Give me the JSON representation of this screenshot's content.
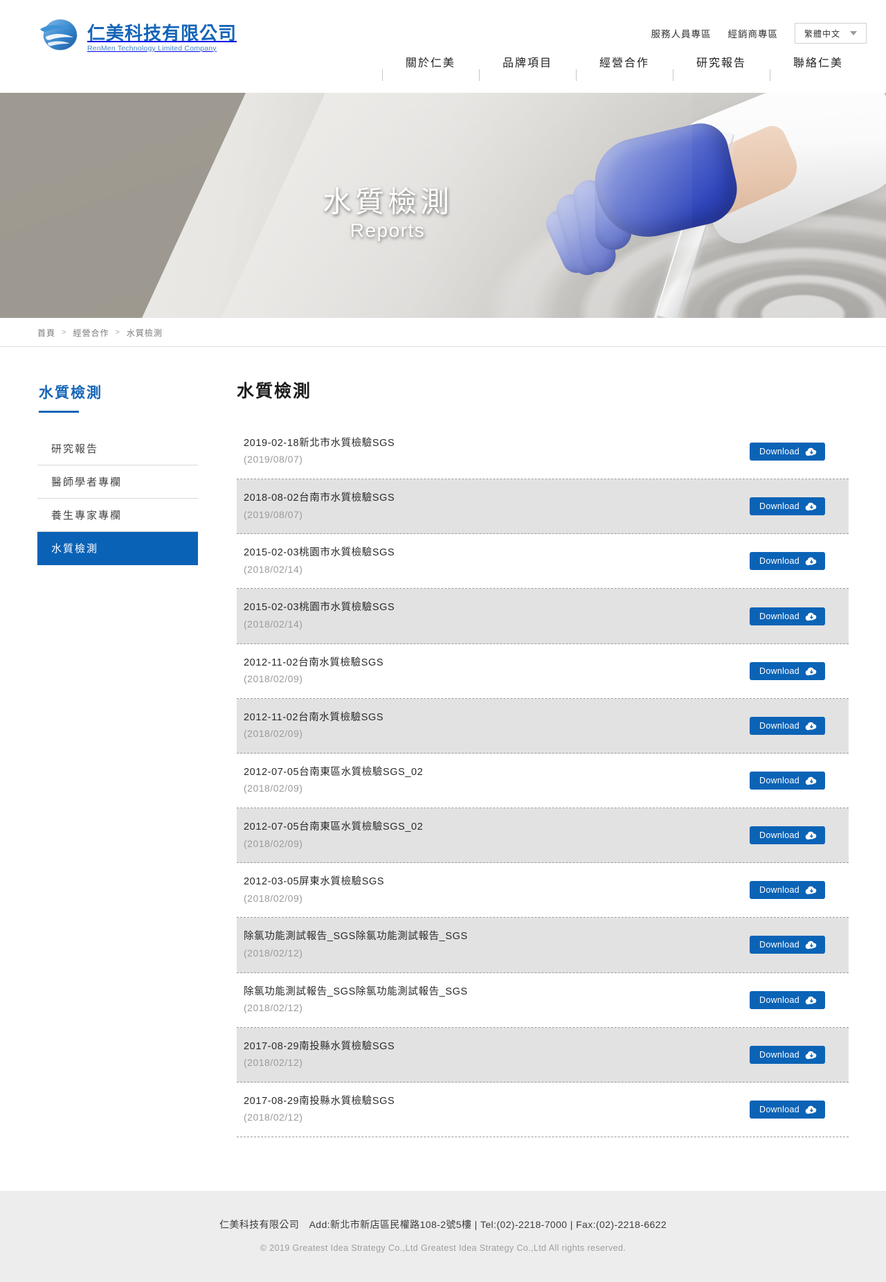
{
  "header": {
    "logo": {
      "icon": "globe-waves-logo-icon",
      "cn": "仁美科技有限公司",
      "en": "RenMen Technology Limited Company",
      "brand_color": "#1565b8"
    },
    "utility_links": [
      {
        "label": "服務人員專區",
        "name": "utility-link-service-staff"
      },
      {
        "label": "經銷商專區",
        "name": "utility-link-distributor"
      }
    ],
    "language": {
      "selected": "繁體中文",
      "caret_icon": "chevron-down-icon"
    },
    "nav": [
      {
        "label": "關於仁美",
        "name": "nav-item-about"
      },
      {
        "label": "品牌項目",
        "name": "nav-item-brand"
      },
      {
        "label": "經營合作",
        "name": "nav-item-cooperation"
      },
      {
        "label": "研究報告",
        "name": "nav-item-research"
      },
      {
        "label": "聯絡仁美",
        "name": "nav-item-contact"
      }
    ]
  },
  "hero": {
    "title_cn": "水質檢測",
    "title_en": "Reports"
  },
  "breadcrumb": {
    "items": [
      "首頁",
      "經營合作",
      "水質檢測"
    ],
    "separator": ">"
  },
  "sidebar": {
    "heading": "水質檢測",
    "items": [
      {
        "label": "研究報告",
        "active": false
      },
      {
        "label": "醫師學者專欄",
        "active": false
      },
      {
        "label": "養生專家專欄",
        "active": false
      },
      {
        "label": "水質檢測",
        "active": true
      }
    ],
    "active_color": "#0a62b7"
  },
  "content": {
    "title": "水質檢測",
    "download_label": "Download",
    "download_icon": "cloud-download-icon",
    "button_color": "#0b63b6",
    "reports": [
      {
        "name": "2019-02-18新北市水質檢驗SGS",
        "date": "(2019/08/07)"
      },
      {
        "name": "2018-08-02台南市水質檢驗SGS",
        "date": "(2019/08/07)"
      },
      {
        "name": "2015-02-03桃園市水質檢驗SGS",
        "date": "(2018/02/14)"
      },
      {
        "name": "2015-02-03桃園市水質檢驗SGS",
        "date": "(2018/02/14)"
      },
      {
        "name": "2012-11-02台南水質檢驗SGS",
        "date": "(2018/02/09)"
      },
      {
        "name": "2012-11-02台南水質檢驗SGS",
        "date": "(2018/02/09)"
      },
      {
        "name": "2012-07-05台南東區水質檢驗SGS_02",
        "date": "(2018/02/09)"
      },
      {
        "name": "2012-07-05台南東區水質檢驗SGS_02",
        "date": "(2018/02/09)"
      },
      {
        "name": "2012-03-05屏東水質檢驗SGS",
        "date": "(2018/02/09)"
      },
      {
        "name": "除氯功能測試報告_SGS除氯功能測試報告_SGS",
        "date": "(2018/02/12)"
      },
      {
        "name": "除氯功能測試報告_SGS除氯功能測試報告_SGS",
        "date": "(2018/02/12)"
      },
      {
        "name": "2017-08-29南投縣水質檢驗SGS",
        "date": "(2018/02/12)"
      },
      {
        "name": "2017-08-29南投縣水質檢驗SGS",
        "date": "(2018/02/12)"
      }
    ]
  },
  "footer": {
    "info": "仁美科技有限公司　Add:新北市新店區民權路108-2號5樓 | Tel:(02)-2218-7000 | Fax:(02)-2218-6622",
    "copyright": "© 2019 Greatest Idea Strategy Co.,Ltd Greatest Idea Strategy Co.,Ltd All rights reserved."
  }
}
